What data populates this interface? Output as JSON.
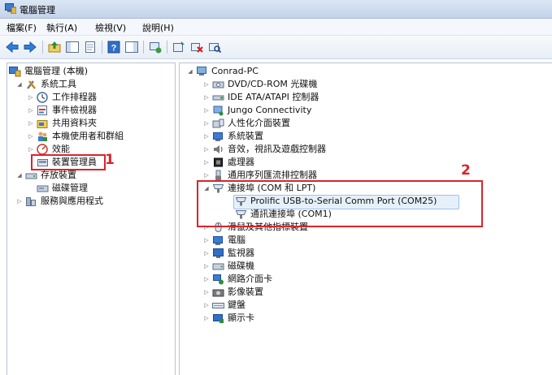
{
  "window": {
    "title": "電腦管理"
  },
  "menu": [
    {
      "label": "檔案(F)"
    },
    {
      "label": "執行(A)"
    },
    {
      "label": "檢視(V)"
    },
    {
      "label": "說明(H)"
    }
  ],
  "toolbar": {
    "icons": [
      "back-icon",
      "forward-icon",
      "up-folder-icon",
      "console-tree-icon",
      "properties-icon",
      "help-icon",
      "action-pane-icon",
      "refresh-icon",
      "update-driver-icon",
      "uninstall-icon",
      "scan-hardware-icon"
    ]
  },
  "left_tree": {
    "root": "電腦管理 (本機)",
    "system_tools": "系統工具",
    "task_scheduler": "工作排程器",
    "event_viewer": "事件檢視器",
    "shared_folders": "共用資料夾",
    "local_users": "本機使用者和群組",
    "performance": "效能",
    "device_manager": "裝置管理員",
    "storage": "存放裝置",
    "disk_management": "磁碟管理",
    "services": "服務與應用程式"
  },
  "device_tree": {
    "computer": "Conrad-PC",
    "dvd": "DVD/CD-ROM 光碟機",
    "ide": "IDE ATA/ATAPI 控制器",
    "jungo": "Jungo Connectivity",
    "hid": "人性化介面裝置",
    "system_devices": "系統裝置",
    "sound": "音效，視訊及遊戲控制器",
    "processors": "處理器",
    "usb": "通用序列匯流排控制器",
    "ports": "連接埠 (COM 和 LPT)",
    "prolific": "Prolific USB-to-Serial Comm Port (COM25)",
    "com1": "通訊連接埠 (COM1)",
    "mice": "滑鼠及其他指標裝置",
    "computer_cat": "電腦",
    "monitors": "監視器",
    "disk_drives": "磁碟機",
    "network": "網路介面卡",
    "imaging": "影像裝置",
    "keyboards": "鍵盤",
    "display": "顯示卡"
  },
  "annotations": {
    "one": "1",
    "two": "2",
    "color": "#d9242b"
  }
}
